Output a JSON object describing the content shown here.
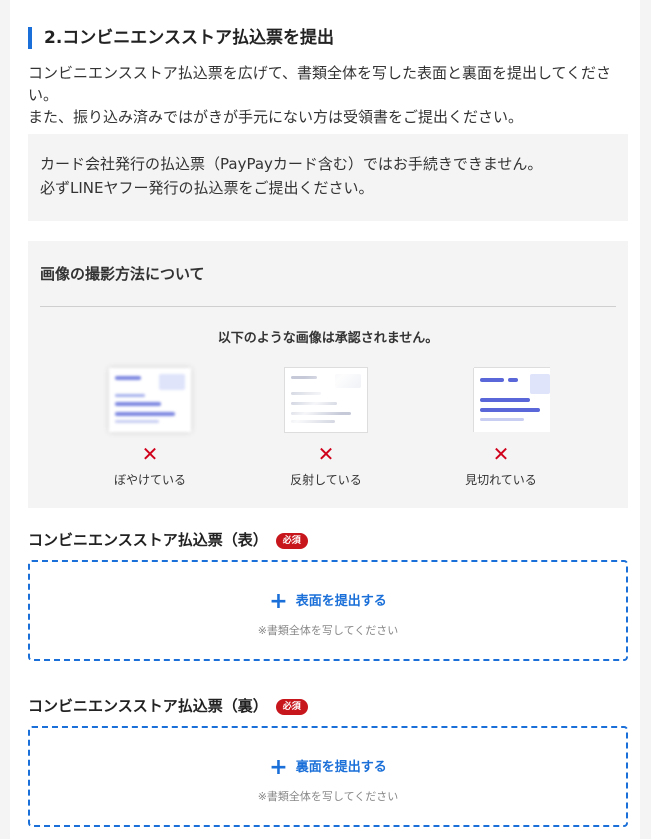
{
  "section": {
    "title": "2.コンビニエンスストア払込票を提出",
    "description_line1": "コンビニエンスストア払込票を広げて、書類全体を写した表面と裏面を提出してください。",
    "description_line2": "また、振り込み済みではがきが手元にない方は受領書をご提出ください。"
  },
  "notice": {
    "line1": "カード会社発行の払込票（PayPayカード含む）ではお手続きできません。",
    "line2": "必ずLINEヤフー発行の払込票をご提出ください。"
  },
  "photo_guide": {
    "title": "画像の撮影方法について",
    "caption": "以下のような画像は承認されません。",
    "examples": [
      {
        "label": "ぼやけている",
        "mark": "✕"
      },
      {
        "label": "反射している",
        "mark": "✕"
      },
      {
        "label": "見切れている",
        "mark": "✕"
      }
    ]
  },
  "upload_front": {
    "heading": "コンビニエンスストア払込票（表）",
    "badge": "必須",
    "action": "表面を提出する",
    "hint": "※書類全体を写してください"
  },
  "upload_back": {
    "heading": "コンビニエンスストア払込票（裏）",
    "badge": "必須",
    "action": "裏面を提出する",
    "hint": "※書類全体を写してください"
  },
  "colors": {
    "accent": "#1a6fd8",
    "required": "#c8161d",
    "error_mark": "#d0021b"
  }
}
